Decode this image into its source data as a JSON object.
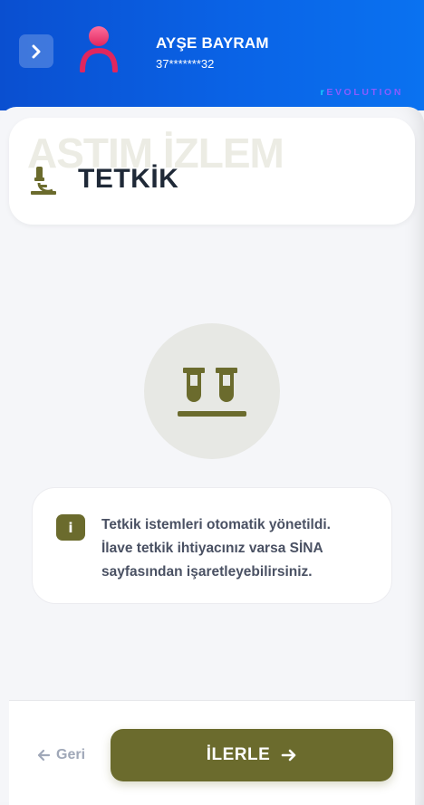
{
  "header": {
    "user_name": "AYŞE BAYRAM",
    "user_id": "37*******32",
    "brand_first": "r",
    "brand_rest": "EVOLUTION"
  },
  "title_card": {
    "watermark": "ASTIM İZLEM",
    "title": "TETKİK",
    "icon": "microscope-icon"
  },
  "hero": {
    "icon": "test-tubes-icon"
  },
  "info": {
    "badge": "i",
    "lines": [
      "Tetkik istemleri otomatik yönetildi.",
      "İlave tetkik ihtiyacınız varsa SİNA",
      "sayfasından işaretleyebilirsiniz."
    ]
  },
  "footer": {
    "back_label": "Geri",
    "next_label": "İLERLE"
  },
  "colors": {
    "header": "#0a63e6",
    "accent": "#6b6b2d",
    "title_text": "#1f2937"
  }
}
